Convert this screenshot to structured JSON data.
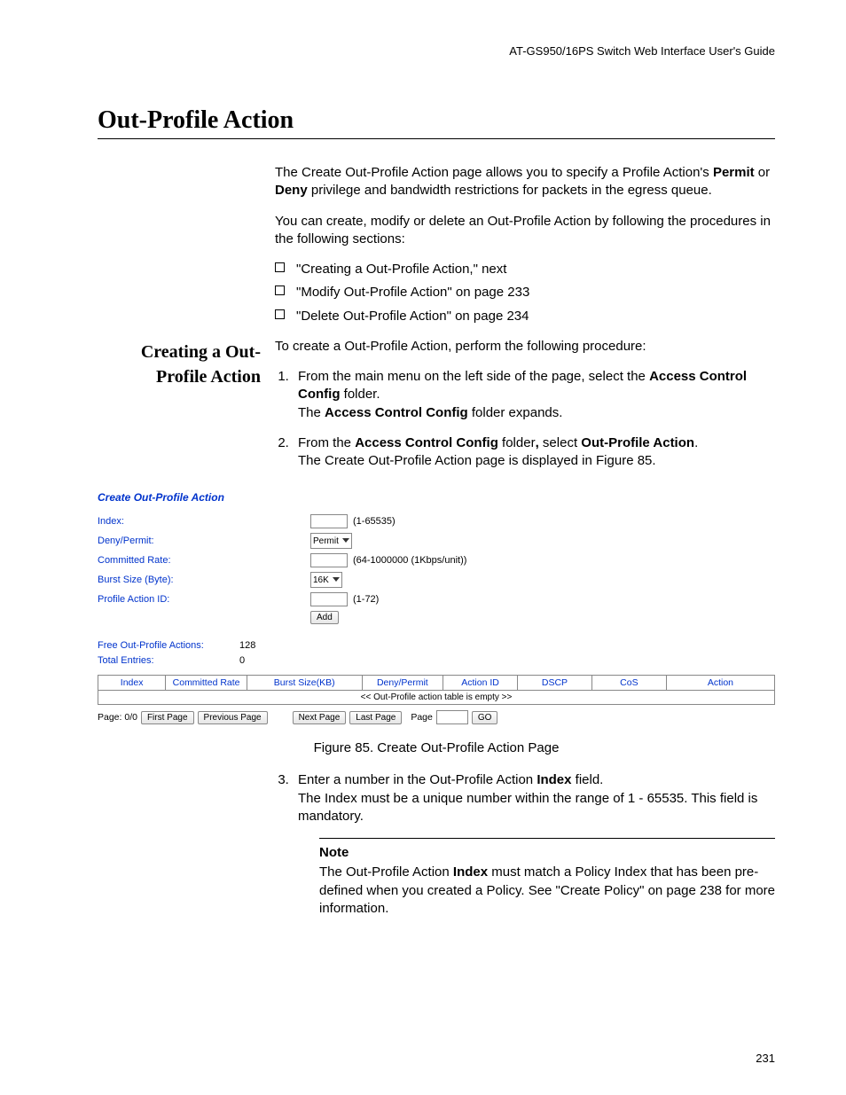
{
  "header": {
    "doc_title": "AT-GS950/16PS Switch Web Interface User's Guide"
  },
  "title": "Out-Profile Action",
  "intro": {
    "p1_a": "The Create Out-Profile Action page allows you to specify a Profile Action's ",
    "p1_b": "Permit",
    "p1_c": " or ",
    "p1_d": "Deny",
    "p1_e": " privilege and bandwidth restrictions for packets in the egress queue.",
    "p2": "You can create, modify or delete an Out-Profile Action by following the procedures in the following sections:",
    "bullets": [
      "\"Creating a Out-Profile Action,\"  next",
      "\"Modify Out-Profile Action\" on page 233",
      "\"Delete Out-Profile Action\" on page 234"
    ]
  },
  "subsection": {
    "heading_l1": "Creating a Out-",
    "heading_l2": "Profile Action",
    "lead": "To create a Out-Profile Action, perform the following procedure:",
    "step1_a": "From the main menu on the left side of the page, select the ",
    "step1_b": "Access Control Config",
    "step1_c": " folder.",
    "step1_d": "The ",
    "step1_e": "Access Control Config",
    "step1_f": " folder expands.",
    "step2_a": "From the ",
    "step2_b": "Access Control Config",
    "step2_c": " folder",
    "step2_comma": ", ",
    "step2_d": "select ",
    "step2_e": "Out-Profile Action",
    "step2_f": ".",
    "step2_g": "The Create Out-Profile Action page is displayed in Figure 85."
  },
  "ui": {
    "panel_title": "Create Out-Profile Action",
    "labels": {
      "index": "Index:",
      "deny_permit": "Deny/Permit:",
      "committed_rate": "Committed Rate:",
      "burst_size": "Burst Size (Byte):",
      "profile_action_id": "Profile Action ID:"
    },
    "hints": {
      "index": "(1-65535)",
      "committed_rate": "(64-1000000 (1Kbps/unit))",
      "profile_action_id": "(1-72)"
    },
    "select_values": {
      "deny_permit": "Permit",
      "burst_size": "16K"
    },
    "add_btn": "Add",
    "stats": {
      "free_label": "Free Out-Profile Actions:",
      "free_value": "128",
      "total_label": "Total Entries:",
      "total_value": "0"
    },
    "columns": [
      "Index",
      "Committed Rate",
      "Burst Size(KB)",
      "Deny/Permit",
      "Action ID",
      "DSCP",
      "CoS",
      "Action"
    ],
    "empty_msg": "<< Out-Profile action table is empty >>",
    "pager": {
      "page_info": "Page: 0/0",
      "first": "First Page",
      "prev": "Previous Page",
      "next": "Next Page",
      "last": "Last Page",
      "page_label": "Page",
      "go": "GO"
    }
  },
  "figure_caption": "Figure 85. Create Out-Profile Action Page",
  "step3": {
    "a": "Enter a number in the Out-Profile Action ",
    "b": "Index",
    "c": " field.",
    "d": "The Index must be a unique number within the range of 1 - 65535. This field is mandatory."
  },
  "note": {
    "label": "Note",
    "a": "The Out-Profile Action ",
    "b": "Index",
    "c": " must match a Policy Index that has been pre-defined when you created a Policy. See \"Create Policy\" on page 238 for more information."
  },
  "page_number": "231"
}
